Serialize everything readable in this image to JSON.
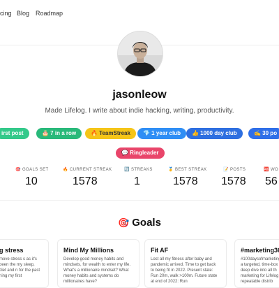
{
  "nav": {
    "items": [
      "cing",
      "Blog",
      "Roadmap"
    ]
  },
  "profile": {
    "username": "jasonleow",
    "bio": "Made Lifelog. I write about indie hacking, writing, productivity."
  },
  "badges": [
    {
      "label": "irst post",
      "color": "#33c98a",
      "text_color": "#ffffff"
    },
    {
      "label": "🎂 7 in a row",
      "color": "#29b97a",
      "text_color": "#ffffff"
    },
    {
      "label": "🔥 TeamStreak",
      "color": "#f5c518",
      "text_color": "#333333"
    },
    {
      "label": "💎 1 year club",
      "color": "#2f8ef5",
      "text_color": "#ffffff"
    },
    {
      "label": "👍 1000 day club",
      "color": "#2e6fe0",
      "text_color": "#ffffff"
    },
    {
      "label": "✍️ 30 po",
      "color": "#2f6fe8",
      "text_color": "#ffffff"
    },
    {
      "label": "💬 Ringleader",
      "color": "#e9456a",
      "text_color": "#ffffff"
    }
  ],
  "stats": [
    {
      "icon": "🎯",
      "label": "GOALS SET",
      "value": "10"
    },
    {
      "icon": "🔥",
      "label": "CURRENT STREAK",
      "value": "1578"
    },
    {
      "icon": "🔄",
      "label": "STREAKS",
      "value": "1"
    },
    {
      "icon": "🥇",
      "label": "BEST STREAK",
      "value": "1578"
    },
    {
      "icon": "📝",
      "label": "POSTS",
      "value": "1578"
    },
    {
      "icon": "🆎",
      "label": "WO",
      "value": "56"
    }
  ],
  "goals": {
    "title": "Goals",
    "icon": "🎯",
    "cards": [
      {
        "title": "g stress",
        "desc": "move stress s as it's been the my sleep, diet and n for the past ning my first"
      },
      {
        "title": "Mind My Millions",
        "desc": "Develop good money habits and mindsets, for wealth to enter my life. What's a millionaire mindset? What money habits and systems do millionaires have?"
      },
      {
        "title": "Fit AF",
        "desc": "Lost all my fitness after baby and pandemic arrived. Time to get back to being fit in 2022. Present state: Run 20m, walk >100m. Future state at end of 2022: Run"
      },
      {
        "title": "#marketing365",
        "desc": "#100daysofmarketing a targeted, time-box deep dive into all th marketing for Lifelog 1 repeatable distrib"
      }
    ]
  }
}
